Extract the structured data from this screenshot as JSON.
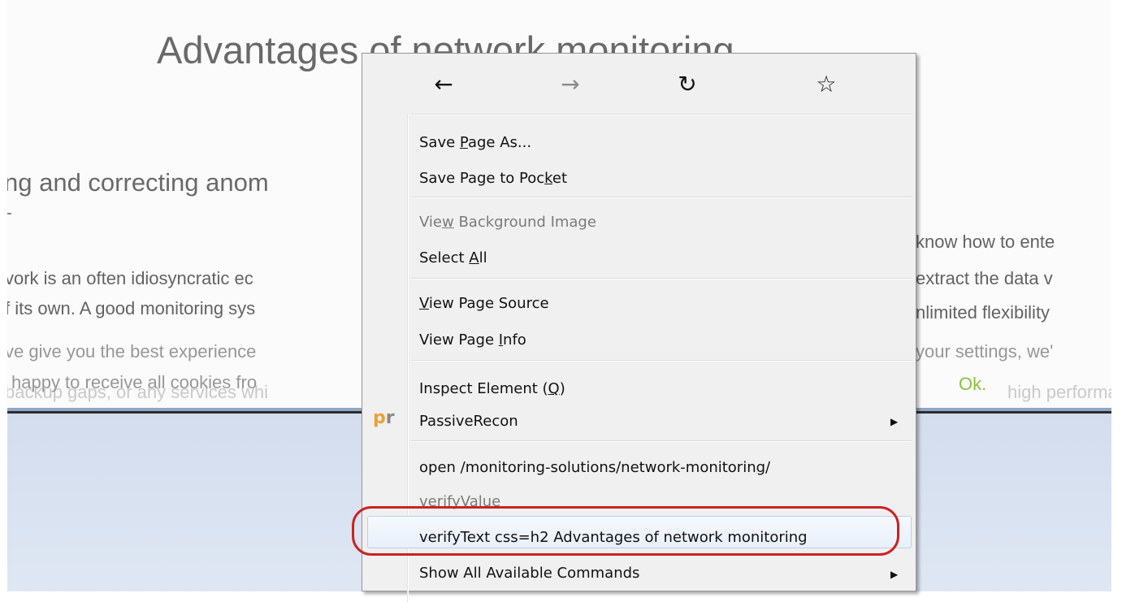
{
  "background_page": {
    "heading": "Advantages of network monitoring",
    "subheading": "ng and correcting anom",
    "lines": [
      {
        "left": "vork is an often idiosyncratic ec",
        "right": "know how to ente"
      },
      {
        "left": "f its own. A good monitoring sys",
        "right": "extract the data v"
      },
      {
        "left": "ve give you the best experience",
        "right": "nlimited flexibility"
      },
      {
        "left": "happy to receive all cookies fro",
        "right": "your settings, we'"
      },
      {
        "left": "",
        "right": "high performanc"
      }
    ],
    "ghost_line": "backup gaps, or any services whi",
    "cookie_ok": "Ok."
  },
  "context_menu": {
    "nav": {
      "back": "←",
      "forward": "→",
      "reload": "↻",
      "bookmark": "☆"
    },
    "items": {
      "save_page_as": {
        "pre": "Save ",
        "key": "P",
        "post": "age As..."
      },
      "save_to_pocket": {
        "pre": "Save Page to Poc",
        "key": "k",
        "post": "et"
      },
      "view_background_image": {
        "pre": "Vie",
        "key": "w",
        "post": " Background Image"
      },
      "select_all": {
        "pre": "Select ",
        "key": "A",
        "post": "ll"
      },
      "view_page_source": {
        "pre": "",
        "key": "V",
        "post": "iew Page Source"
      },
      "view_page_info": {
        "pre": "View Page ",
        "key": "I",
        "post": "nfo"
      },
      "inspect_element": {
        "pre": "Inspect Element (",
        "key": "Q",
        "post": ")"
      },
      "passive_recon": "PassiveRecon",
      "open_command": "open /monitoring-solutions/network-monitoring/",
      "verify_value": "verifyValue",
      "verify_text": "verifyText css=h2 Advantages of network monitoring",
      "show_all_commands": "Show All Available Commands"
    },
    "passive_recon_icon": {
      "main": "p",
      "rest": "r"
    }
  }
}
